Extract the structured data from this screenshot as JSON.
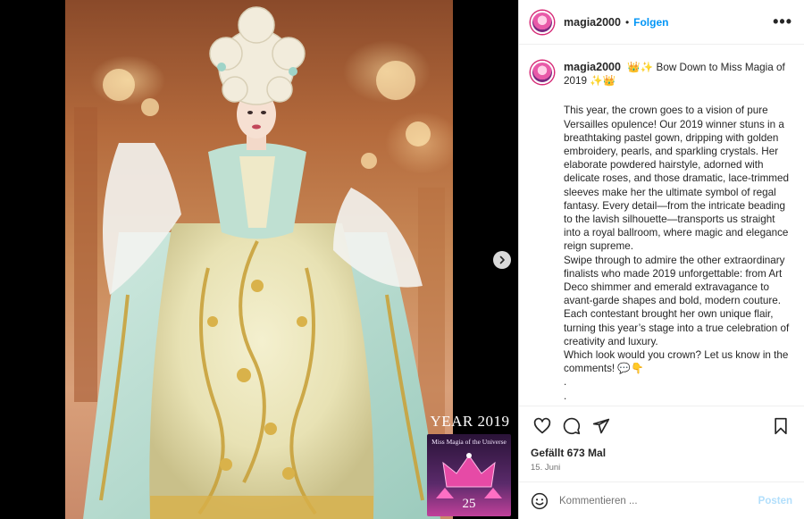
{
  "post": {
    "username": "magia2000",
    "follow_label": "Folgen",
    "separator": "•",
    "more_label": "•••"
  },
  "caption": {
    "username": "magia2000",
    "title": "👑✨ Bow Down to Miss Magia of 2019 ✨👑",
    "body": "This year, the crown goes to a vision of pure Versailles opulence! Our 2019 winner stuns in a breathtaking pastel gown, dripping with golden embroidery, pearls, and sparkling crystals. Her elaborate powdered hairstyle, adorned with delicate roses, and those dramatic, lace-trimmed sleeves make her the ultimate symbol of regal fantasy. Every detail—from the intricate beading to the lavish silhouette—transports us straight into a royal ballroom, where magic and elegance reign supreme.\nSwipe through to admire the other extraordinary finalists who made 2019 unforgettable: from Art Deco shimmer and emerald extravagance to avant-garde shapes and bold, modern couture. Each contestant brought her own unique flair, turning this year’s stage into a true celebration of creativity and luxury.\nWhich look would you crown? Let us know in the comments! 💬👇\n.\n.\n.\n.\n.\n.."
  },
  "image_overlay": {
    "year_text": "YEAR 2019",
    "subtitle": "Miss Magia of the Universe",
    "number": "25"
  },
  "stats": {
    "likes": "Gefällt 673 Mal",
    "date": "15. Juni"
  },
  "comment_box": {
    "placeholder": "Kommentieren ...",
    "post_label": "Posten"
  },
  "icons": {
    "like": "heart-icon",
    "comment": "comment-icon",
    "share": "share-icon",
    "save": "bookmark-icon",
    "emoji": "smiley-icon",
    "next": "chevron-right-icon"
  },
  "colors": {
    "accent": "#0095f6",
    "post_disabled": "#b2dffc",
    "text": "#262626",
    "muted": "#737373"
  }
}
